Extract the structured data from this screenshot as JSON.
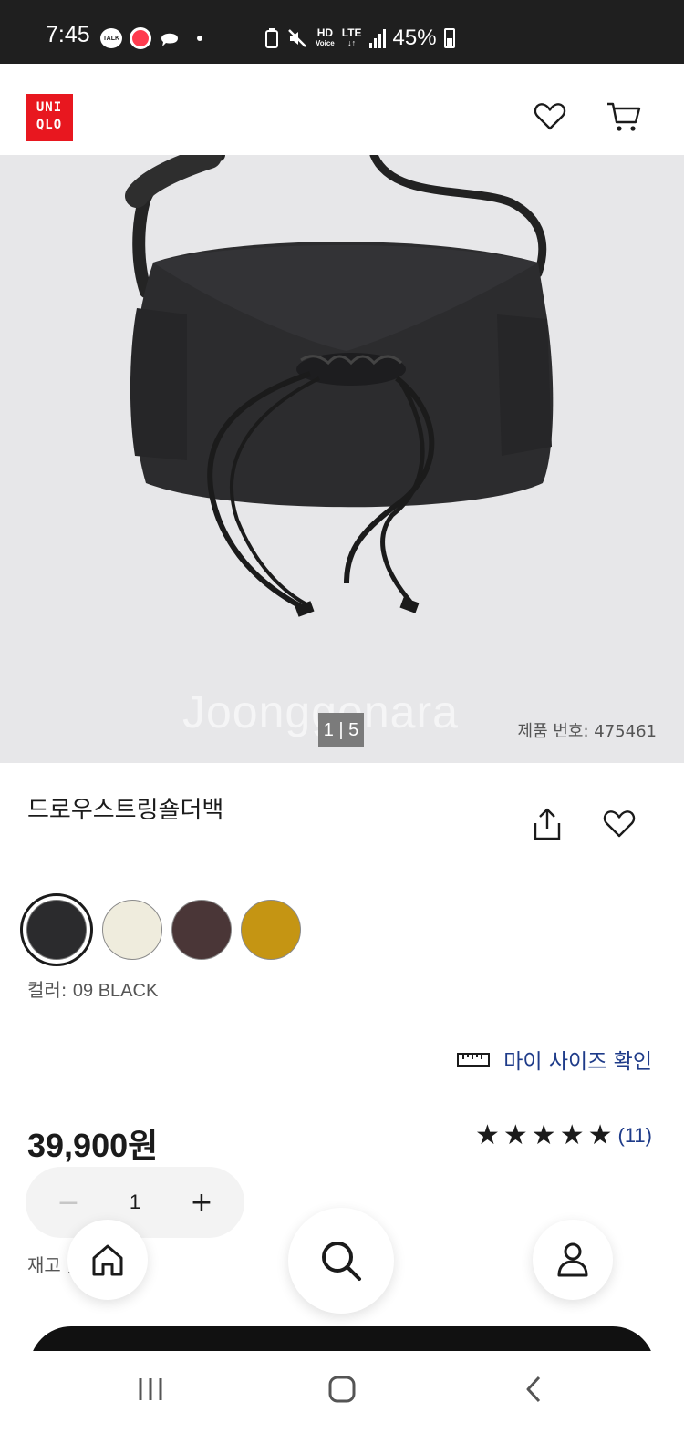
{
  "status_bar": {
    "time": "7:45",
    "talk_badge": "TALK",
    "network_hd": "HD",
    "network_voice": "Voice",
    "network_lte": "LTE",
    "battery_pct": "45%"
  },
  "header": {
    "logo_line1": "UNI",
    "logo_line2": "QLO",
    "brand_color": "#e8171f"
  },
  "hero": {
    "image_counter": "1 | 5",
    "product_number": "제품 번호: 475461",
    "watermark": "Joonggonara"
  },
  "product": {
    "title": "드로우스트링숄더백",
    "colors": [
      {
        "name": "09 BLACK",
        "hex": "#2b2b2d",
        "selected": true
      },
      {
        "name": "",
        "hex": "#efecdd",
        "selected": false
      },
      {
        "name": "",
        "hex": "#4a3637",
        "selected": false
      },
      {
        "name": "",
        "hex": "#c59513",
        "selected": false
      }
    ],
    "color_label_prefix": "컬러: ",
    "color_label_value": "09 BLACK",
    "size_link": "마이 사이즈 확인",
    "price_number": "39,900",
    "price_unit": "원",
    "rating_stars": 5,
    "review_count": "(11)",
    "quantity": "1",
    "stock_text": "재고 있"
  },
  "icons": {
    "header": [
      "heart-icon",
      "cart-icon"
    ],
    "product": [
      "share-icon",
      "heart-icon",
      "ruler-icon",
      "star-icon"
    ],
    "floating_nav": [
      "home-icon",
      "search-icon",
      "user-icon"
    ],
    "system_nav": [
      "recents-icon",
      "home-icon",
      "back-icon"
    ]
  }
}
